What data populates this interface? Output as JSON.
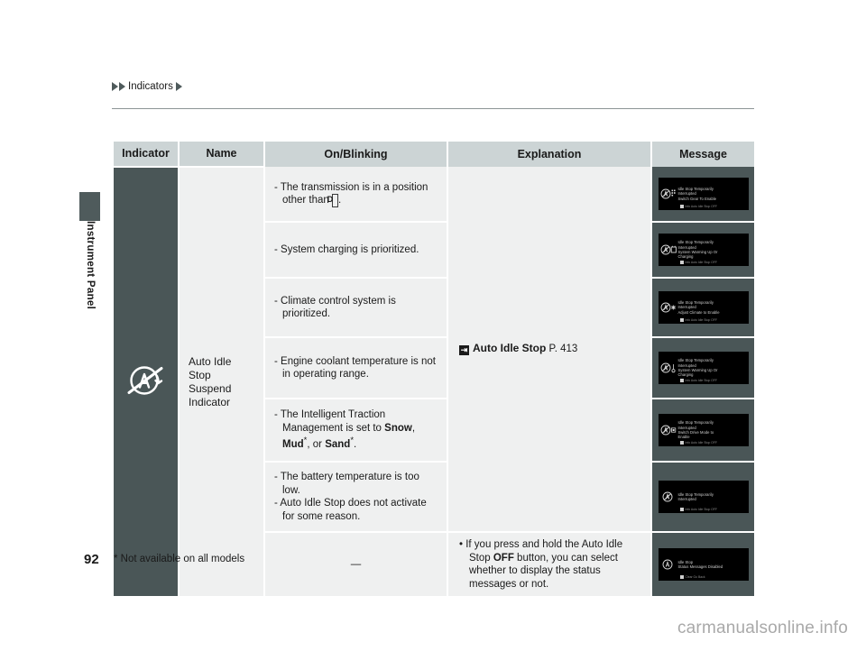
{
  "breadcrumb": {
    "label": "Indicators"
  },
  "side_tab": {
    "label": "Instrument Panel"
  },
  "table": {
    "headers": {
      "indicator": "Indicator",
      "name": "Name",
      "on_blinking": "On/Blinking",
      "explanation": "Explanation",
      "message": "Message"
    },
    "indicator_icon": "auto-idle-stop-suspend-icon",
    "name": "Auto Idle Stop Suspend Indicator",
    "explanation": {
      "ref_icon": "jump-to-page-icon",
      "ref_title": "Auto Idle Stop",
      "ref_page": "P. 413"
    },
    "rows": [
      {
        "on_blinking": [
          "- The transmission is in a position other than",
          "D",
          "."
        ],
        "on_blinking_type": "transmission",
        "message": {
          "icon": "idle-stop-gear-icon",
          "lines": [
            "Idle Stop Temporarily",
            "Interrupted",
            "Switch Gear To Enable"
          ],
          "footer": "Info          Auto Idle Stop OFF"
        }
      },
      {
        "on_blinking": [
          "- System charging is prioritized."
        ],
        "on_blinking_type": "plain",
        "message": {
          "icon": "idle-stop-battery-icon",
          "lines": [
            "Idle Stop Temporarily",
            "Interrupted",
            "System Warming Up Or",
            "Charging"
          ],
          "footer": "Info          Auto Idle Stop OFF"
        }
      },
      {
        "on_blinking": [
          "- Climate control system is prioritized."
        ],
        "on_blinking_type": "plain",
        "message": {
          "icon": "idle-stop-climate-icon",
          "lines": [
            "Idle Stop Temporarily",
            "Interrupted",
            "Adjust Climate to Enable"
          ],
          "footer": "Info          Auto Idle Stop OFF"
        }
      },
      {
        "on_blinking": [
          "- Engine coolant temperature is not in operating range."
        ],
        "on_blinking_type": "plain",
        "message": {
          "icon": "idle-stop-temp-icon",
          "lines": [
            "Idle Stop Temporarily",
            "Interrupted",
            "System Warming Up Or",
            "Charging"
          ],
          "footer": "Info          Auto Idle Stop OFF"
        }
      },
      {
        "on_blinking_type": "itm",
        "on_blinking_itm": {
          "pre": "- The Intelligent Traction Management is set to ",
          "b1": "Snow",
          "sep1": ", ",
          "b2": "Mud",
          "star2": "*",
          "sep2": ", or ",
          "b3": "Sand",
          "star3": "*",
          "end": "."
        },
        "message": {
          "icon": "idle-stop-drive-mode-icon",
          "lines": [
            "Idle Stop Temporarily",
            "Interrupted",
            "Switch Drive Mode to",
            "Enable"
          ],
          "footer": "Info          Auto Idle Stop OFF"
        }
      },
      {
        "on_blinking": [
          "- The battery temperature is too low.",
          "- Auto Idle Stop does not activate for some reason."
        ],
        "on_blinking_type": "multi",
        "message": {
          "icon": "idle-stop-generic-icon",
          "lines": [
            "Idle Stop Temporarily",
            "Interrupted"
          ],
          "footer": "Info          Auto Idle Stop OFF"
        }
      },
      {
        "on_blinking": [
          "—"
        ],
        "on_blinking_type": "dash",
        "explanation_bullet": {
          "pre": "• If you press and hold the Auto Idle Stop ",
          "bold": "OFF",
          "post": " button, you can select whether to display the status messages or not."
        },
        "message": {
          "icon": "idle-stop-disabled-icon",
          "lines": [
            "Idle Stop",
            "Status Messages Disabled"
          ],
          "footer": "Clear          Go Back"
        }
      }
    ]
  },
  "footer": {
    "page_number": "92",
    "footnote": "* Not available on all models",
    "watermark": "carmanualsonline.info"
  },
  "colors": {
    "header_bg": "#ccd4d5",
    "cell_bg": "#eff0f0",
    "dark_panel": "#4a5657",
    "accent": "#4f5b5c",
    "text": "#1a1a1a"
  }
}
